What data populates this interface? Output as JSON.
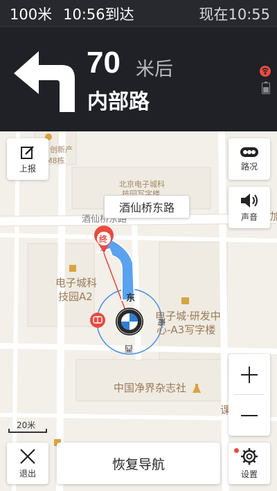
{
  "status": {
    "distance_to_dest": "100米",
    "arrival": "10:56到达",
    "now": "现在10:55"
  },
  "turn": {
    "direction_icon": "turn-left-arrow-icon",
    "distance": "70",
    "after": "米后",
    "road": "内部路",
    "gps_icon": "gps-signal-icon",
    "battery_icon": "battery-icon"
  },
  "map": {
    "current_road": "酒仙桥东路",
    "labels": {
      "poi_chuangxin": "创新产",
      "poi_m8": "M8栋",
      "poi_beijing_electronics": "北京电子城科",
      "poi_beijing_electronics_2": "技园写字楼",
      "road_jiuxianqiao": "酒仙桥东路",
      "poi_park_a2_line1": "电子城科",
      "poi_park_a2_line2": "技园A2",
      "poi_rd_line1": "电子城·研发中",
      "poi_rd_line2": "心-A3写字楼",
      "poi_magazine": "中国净界杂志社",
      "poi_jia": "加",
      "poi_ke": "课",
      "compass_east": "东",
      "compass_west": "西",
      "compass_south": "南"
    },
    "destination_marker": "终",
    "scale_label": "20米"
  },
  "buttons": {
    "report": "上报",
    "traffic": "路况",
    "sound": "声音",
    "exit": "退出",
    "resume": "恢复导航",
    "settings": "设置"
  },
  "colors": {
    "route_blue": "#3a8be8",
    "destination_red": "#e94b40",
    "panel_dark": "#1f2127"
  }
}
